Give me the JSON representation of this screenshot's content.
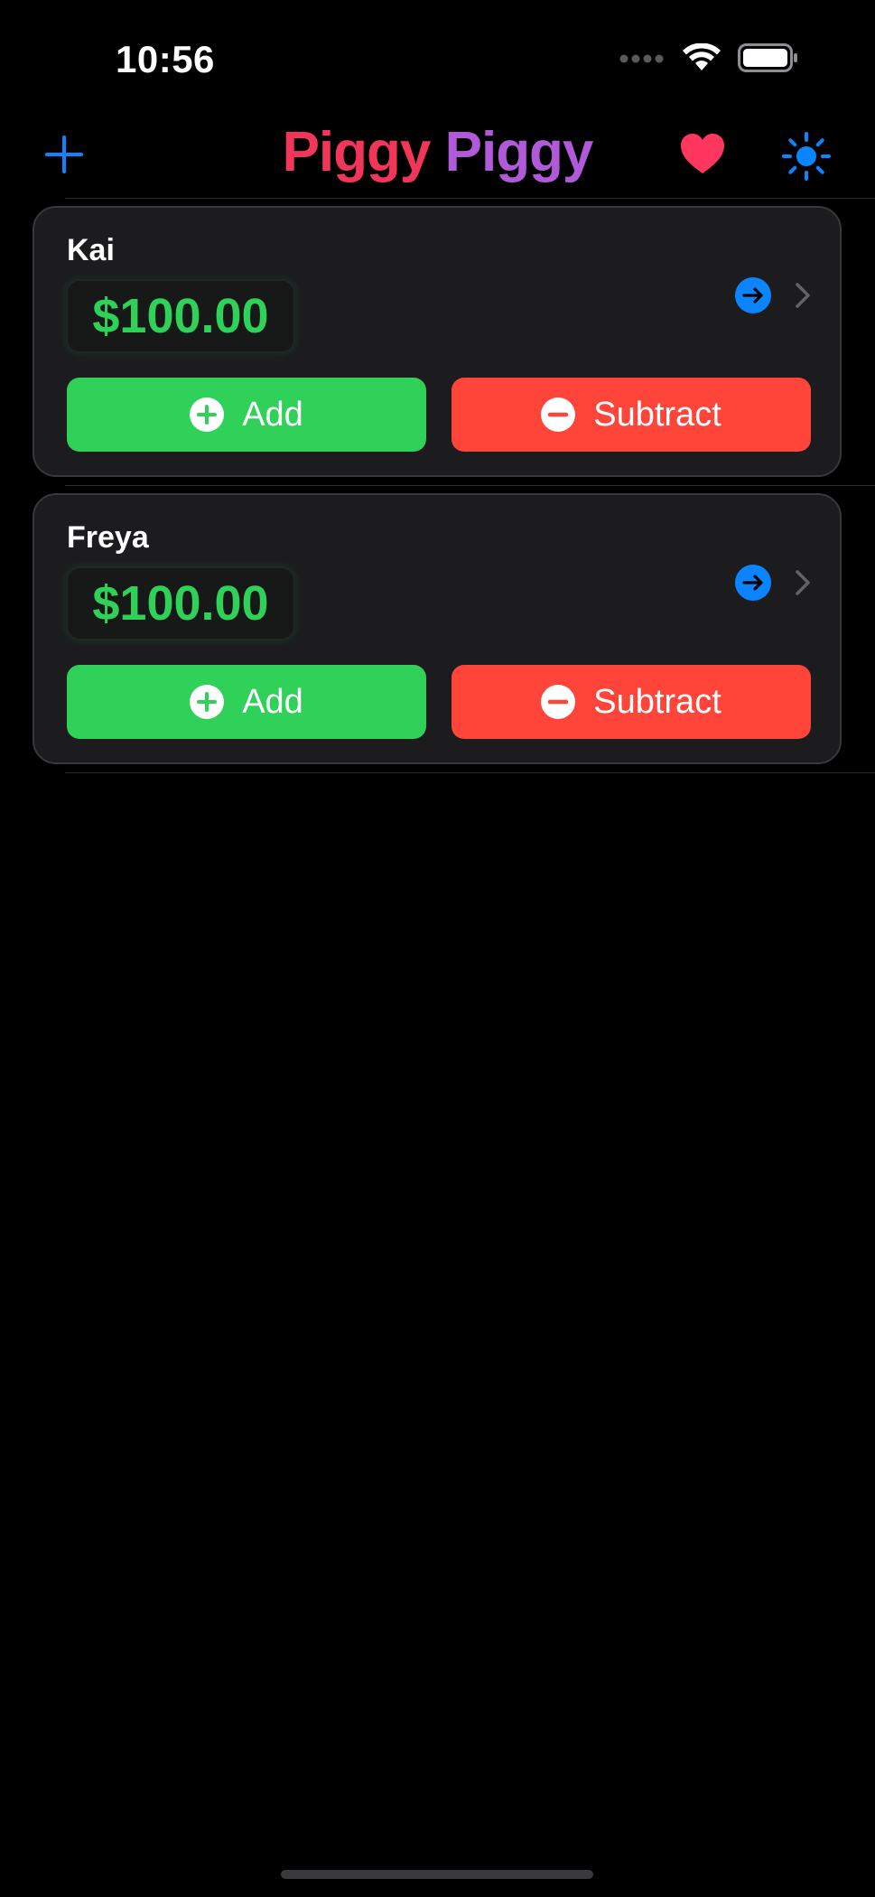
{
  "status_bar": {
    "time": "10:56",
    "icons": [
      "signal-dots-icon",
      "wifi-icon",
      "battery-icon"
    ]
  },
  "nav": {
    "title_part1": "Piggy",
    "title_part2": "Piggy",
    "icons": [
      "plus-icon",
      "heart-icon",
      "sun-icon"
    ],
    "colors": {
      "accent": "#0a84ff",
      "title_part1": "#f2365a",
      "title_part2": "#b15ad9",
      "heart": "#ff375f"
    }
  },
  "accounts": [
    {
      "name": "Kai",
      "balance": "$100.00",
      "add_label": "Add",
      "subtract_label": "Subtract"
    },
    {
      "name": "Freya",
      "balance": "$100.00",
      "add_label": "Add",
      "subtract_label": "Subtract"
    }
  ],
  "colors": {
    "add_button": "#30d158",
    "subtract_button": "#ff453a",
    "balance_text": "#30d158",
    "card_background": "#1c1c1e"
  }
}
